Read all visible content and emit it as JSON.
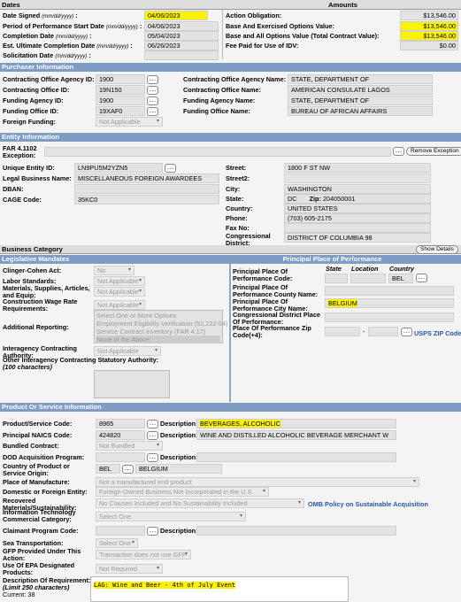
{
  "dates": {
    "header": "Dates",
    "date_signed_label": "Date Signed",
    "date_signed": "04/06/2023",
    "pop_start_label": "Period of Performance Start Date",
    "pop_start": "04/06/2023",
    "completion_label": "Completion Date",
    "completion": "05/04/2023",
    "ult_completion_label": "Est. Ultimate Completion Date",
    "ult_completion": "06/26/2023",
    "solicitation_label": "Solicitation Date",
    "solicitation": "",
    "fmt": "(mm/dd/yyyy)"
  },
  "amounts": {
    "header": "Amounts",
    "action_obligation_label": "Action Obligation:",
    "action_obligation": "$13,546.00",
    "base_exercised_label": "Base And Exercised Options Value:",
    "base_exercised": "$13,546.00",
    "base_all_label": "Base and All Options Value (Total Contract Value):",
    "base_all": "$13,546.00",
    "fee_label": "Fee Paid for Use of IDV:",
    "fee": "$0.00"
  },
  "purchaser": {
    "header": "Purchaser Information",
    "co_agency_id_label": "Contracting Office Agency ID:",
    "co_agency_id": "1900",
    "co_id_label": "Contracting Office ID:",
    "co_id": "19N150",
    "fund_agency_id_label": "Funding Agency ID:",
    "fund_agency_id": "1900",
    "fund_office_id_label": "Funding Office ID:",
    "fund_office_id": "19XAF0",
    "foreign_funding_label": "Foreign Funding:",
    "foreign_funding": "Not Applicable",
    "co_agency_name_label": "Contracting Office Agency Name:",
    "co_agency_name": "STATE, DEPARTMENT OF",
    "co_name_label": "Contracting Office Name:",
    "co_name": "AMERICAN CONSULATE LAGOS",
    "fund_agency_name_label": "Funding Agency Name:",
    "fund_agency_name": "STATE, DEPARTMENT OF",
    "fund_office_name_label": "Funding Office Name:",
    "fund_office_name": "BUREAU OF AFRICAN AFFAIRS"
  },
  "entity": {
    "header": "Entity Information",
    "far_label": "FAR 4.1102",
    "exception_label": "Exception:",
    "remove_exception": "Remove Exception",
    "uei_label": "Unique Entity ID:",
    "uei": "LN9PU5M2YZN5",
    "legal_label": "Legal Business Name:",
    "legal": "MISCELLANEOUS FOREIGN AWARDEES",
    "dban_label": "DBAN:",
    "cage_label": "CAGE Code:",
    "cage": "35KC0",
    "street_label": "Street:",
    "street": "1800 F ST NW",
    "street2_label": "Street2:",
    "city_label": "City:",
    "city": "WASHINGTON",
    "state_label": "State:",
    "state": "DC",
    "zip_label": "Zip:",
    "zip": "204050001",
    "country_label": "Country:",
    "country": "UNITED STATES",
    "phone_label": "Phone:",
    "phone": "(703) 605-2175",
    "fax_label": "Fax No:",
    "congressional_label": "Congressional District:",
    "congressional": "DISTRICT OF COLUMBIA 98"
  },
  "business_category": {
    "header": "Business Category",
    "show_details": "Show Details"
  },
  "legislative": {
    "header": "Legislative Mandates",
    "clinger_label": "Clinger-Cohen Act:",
    "clinger": "No",
    "labor_label": "Labor Standards:",
    "labor": "Not Applicable",
    "materials_label": "Materials, Supplies, Articles, and Equip:",
    "materials": "Not Applicable",
    "construction_label": "Construction Wage Rate Requirements:",
    "construction": "Not Applicable",
    "additional_label": "Additional Reporting:",
    "additional_options": [
      "Select One or More Options",
      "Employment Eligibility Verification (52.222-54)",
      "Service Contract Inventory (FAR 4.17)",
      "None of the Above"
    ],
    "interagency_label": "Interagency Contracting Authority:",
    "interagency": "Not Applicable",
    "other_label": "Other Interagency Contracting Statutory Authority:",
    "other_sub": "(100 characters)"
  },
  "place": {
    "header": "Principal Place of Performance",
    "pop_code_label": "Principal Place Of Performance Code:",
    "col_state": "State",
    "col_location": "Location",
    "col_country": "Country",
    "country_code": "BEL",
    "county_label": "Principal Place Of Performance County Name:",
    "city_label": "Principal Place Of Performance City Name:",
    "city": "BELGIUM",
    "cong_label": "Congressional District Place Of Performance:",
    "zip_label": "Place Of Performance Zip Code(+4):",
    "usps": "USPS ZIP Codes"
  },
  "product": {
    "header": "Product Or Service Information",
    "psc_label": "Product/Service Code:",
    "psc": "8965",
    "desc_label": "Description:",
    "psc_desc": "BEVERAGES, ALCOHOLIC",
    "naics_label": "Principal NAICS Code:",
    "naics": "424820",
    "naics_desc": "WINE AND DISTILLED ALCOHOLIC BEVERAGE MERCHANT W",
    "bundled_label": "Bundled Contract:",
    "bundled": "Not Bundled",
    "dod_label": "DOD Acquisition Program:",
    "country_label": "Country of Product or Service Origin:",
    "country_code": "BEL",
    "country_name": "BELGIUM",
    "manufacture_label": "Place of Manufacture:",
    "manufacture": "Not a manufactured end product",
    "domestic_label": "Domestic or Foreign Entity:",
    "domestic": "Foreign-Owned Business Not Incorporated in the U.S.",
    "recovered_label": "Recovered Materials/Sustainability:",
    "recovered": "No Clauses Included and No Sustainability Included",
    "omb": "OMB Policy on Sustainable Acquisition",
    "it_label": "Information Technology Commercial Category:",
    "it": "Select One",
    "claimant_label": "Claimant Program Code:",
    "sea_label": "Sea Transportation:",
    "sea": "Select One",
    "gfp_label": "GFP Provided Under This Action:",
    "gfp": "Transaction does not use GFP",
    "epa_label": "Use Of EPA Designated Products:",
    "epa": "Not Required",
    "req_label": "Description Of Requirement:",
    "req_limit": "(Limit 250 characters)",
    "req_current": "Current: 38",
    "requirement": "LAG: Wine and Beer - 4th of July Event"
  },
  "colors": {
    "header": "#7f9cc4",
    "highlight": "#fff200",
    "field": "#e3e3e3"
  }
}
